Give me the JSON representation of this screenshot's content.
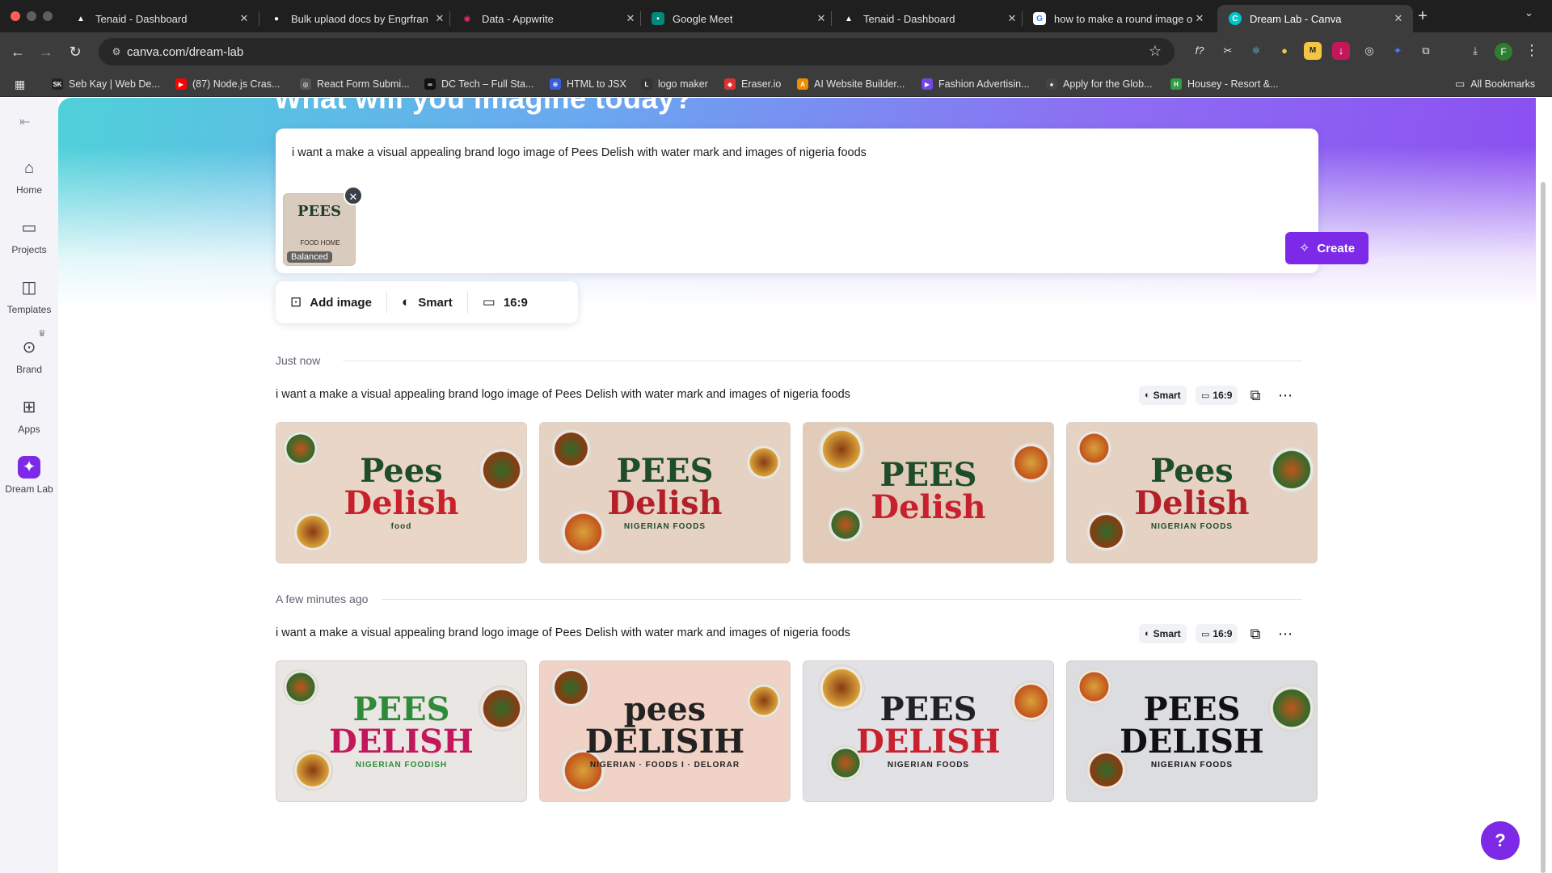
{
  "browser": {
    "tabs": [
      {
        "label": "Tenaid - Dashboard",
        "icon": "triangle-icon",
        "icon_color": "#000000"
      },
      {
        "label": "Bulk uplaod docs by Engrfran",
        "icon": "github-icon",
        "icon_color": "#24292f"
      },
      {
        "label": "Data - Appwrite",
        "icon": "appwrite-icon",
        "icon_color": "#f02e65"
      },
      {
        "label": "Google Meet",
        "icon": "meet-icon",
        "icon_color": "#00897b"
      },
      {
        "label": "Tenaid - Dashboard",
        "icon": "triangle-icon",
        "icon_color": "#000000"
      },
      {
        "label": "how to make a round image o",
        "icon": "google-icon",
        "icon_color": "#4285f4"
      },
      {
        "label": "Dream Lab - Canva",
        "icon": "canva-icon",
        "icon_color": "#00c4cc",
        "active": true
      }
    ],
    "url": "canva.com/dream-lab",
    "profile_initial": "F",
    "bookmarks": [
      {
        "label": "Seb Kay | Web De...",
        "icon_color": "#222222",
        "icon_text": "SK"
      },
      {
        "label": "(87) Node.js Cras...",
        "icon_color": "#ff0000",
        "icon_text": "▶"
      },
      {
        "label": "React Form Submi...",
        "icon_color": "#555555",
        "icon_text": "◎"
      },
      {
        "label": "DC Tech – Full Sta...",
        "icon_color": "#111111",
        "icon_text": "∞"
      },
      {
        "label": "HTML to JSX",
        "icon_color": "#3b5bdb",
        "icon_text": "⊕"
      },
      {
        "label": "logo maker",
        "icon_color": "#333333",
        "icon_text": "L"
      },
      {
        "label": "Eraser.io",
        "icon_color": "#e03131",
        "icon_text": "◆"
      },
      {
        "label": "AI Website Builder...",
        "icon_color": "#f08c00",
        "icon_text": "A"
      },
      {
        "label": "Fashion Advertisin...",
        "icon_color": "#7048e8",
        "icon_text": "▶"
      },
      {
        "label": "Apply for the Glob...",
        "icon_color": "#444444",
        "icon_text": "♠"
      },
      {
        "label": "Housey - Resort &...",
        "icon_color": "#2f9e44",
        "icon_text": "H"
      }
    ],
    "all_bookmarks": "All Bookmarks"
  },
  "sidebar": {
    "items": [
      {
        "label": "Home",
        "icon": "home-icon"
      },
      {
        "label": "Projects",
        "icon": "folder-icon"
      },
      {
        "label": "Templates",
        "icon": "templates-icon"
      },
      {
        "label": "Brand",
        "icon": "brand-icon"
      },
      {
        "label": "Apps",
        "icon": "apps-icon"
      },
      {
        "label": "Dream Lab",
        "icon": "dream-lab-icon",
        "active": true
      }
    ]
  },
  "hero": {
    "title": "What will you imagine today?"
  },
  "prompt": {
    "text": "i want a make a visual appealing brand logo image of Pees Delish with water mark and images of nigeria foods",
    "reference_image": {
      "logo_line1": "PEES",
      "logo_line2": "FOOD HOME",
      "badge": "Balanced"
    },
    "create_label": "Create"
  },
  "options": {
    "add_image": "Add image",
    "style": "Smart",
    "aspect": "16:9"
  },
  "generations": [
    {
      "time_label": "Just now",
      "prompt": "i want a make a visual appealing brand logo image of Pees Delish with water mark and images of nigeria foods",
      "style": "Smart",
      "aspect": "16:9",
      "images": [
        {
          "line1": "Pees",
          "line2": "Delish",
          "line3": "food",
          "bg": "#ead6c6",
          "c1": "#1e4d2b",
          "c2": "#c8202d"
        },
        {
          "line1": "PEES",
          "line2": "Delish",
          "line3": "NIGERIAN FOODS",
          "bg": "#e6d2c3",
          "c1": "#1e4d2b",
          "c2": "#b3202a"
        },
        {
          "line1": "PEES",
          "line2": "Delish",
          "line3": "",
          "bg": "#e2cbb8",
          "c1": "#1e4d2b",
          "c2": "#c8202d"
        },
        {
          "line1": "Pees",
          "line2": "Delish",
          "line3": "NIGERIAN FOODS",
          "bg": "#e6d2c3",
          "c1": "#1e4d2b",
          "c2": "#b3202a"
        }
      ]
    },
    {
      "time_label": "A few minutes ago",
      "prompt": "i want a make a visual appealing brand logo image of Pees Delish with water mark and images of nigeria foods",
      "style": "Smart",
      "aspect": "16:9",
      "images": [
        {
          "line1": "PEES",
          "line2": "DELISH",
          "line3": "NIGERIAN FOODISH",
          "bg": "#e9e6e3",
          "c1": "#2f8a3a",
          "c2": "#c2185b"
        },
        {
          "line1": "pees",
          "line2": "DELISIH",
          "line3": "NIGERIAN · FOODS I · DELORAR",
          "bg": "#f0d2c6",
          "c1": "#222222",
          "c2": "#222222"
        },
        {
          "line1": "PEES",
          "line2": "DELISH",
          "line3": "NIGERIAN FOODS",
          "bg": "#e2e2e6",
          "c1": "#222222",
          "c2": "#c8202d"
        },
        {
          "line1": "PEES",
          "line2": "DELISH",
          "line3": "NIGERIAN FOODS",
          "bg": "#dcdde1",
          "c1": "#111111",
          "c2": "#111111"
        }
      ]
    }
  ],
  "help_label": "?"
}
